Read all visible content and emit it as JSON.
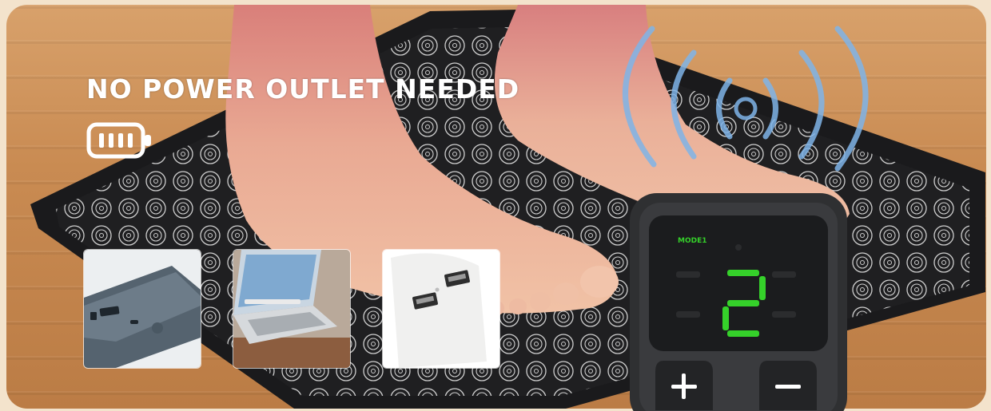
{
  "headline": "NO POWER OUTLET NEEDED",
  "icons": {
    "battery": "battery-icon",
    "wireless_waves": "vibration-waves-icon"
  },
  "power_sources": [
    {
      "name": "power-bank"
    },
    {
      "name": "laptop"
    },
    {
      "name": "usb-wall-charger"
    }
  ],
  "remote": {
    "mode_label": "MODE1",
    "display_digit": "2",
    "buttons": [
      "plus",
      "minus"
    ]
  },
  "colors": {
    "headline": "#ffffff",
    "display_green": "#35d12a",
    "waves": "#7fb4e8",
    "mat": "#1f1f21"
  }
}
